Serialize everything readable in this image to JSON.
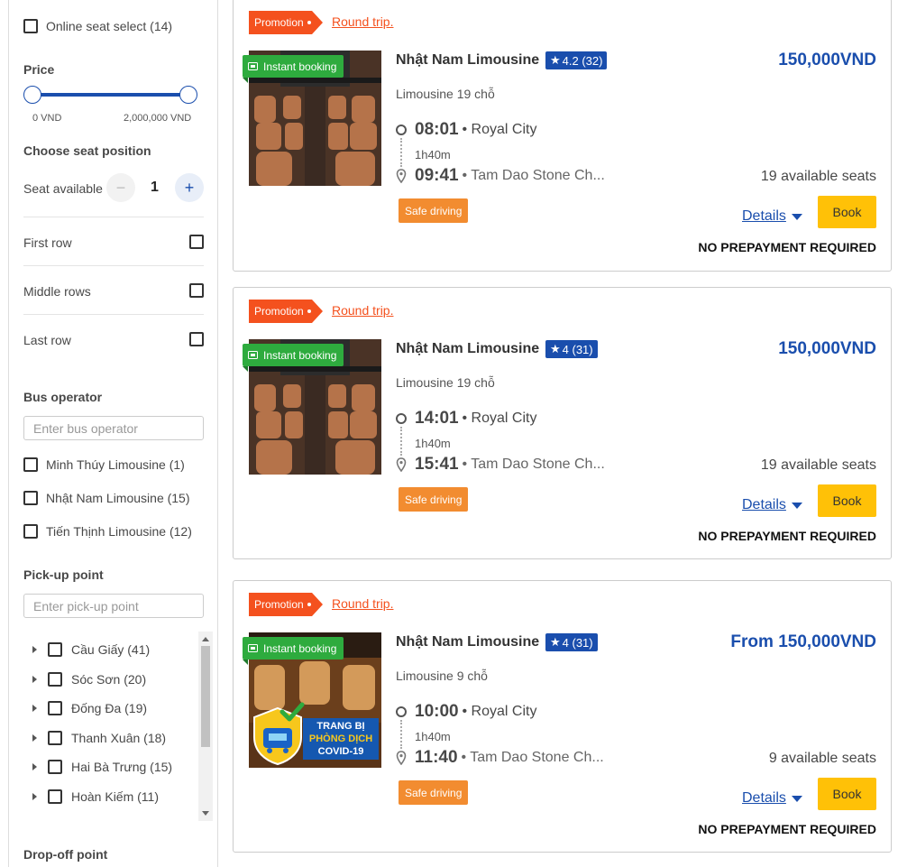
{
  "filters": {
    "online_seat": "Online seat select (14)",
    "price": {
      "title": "Price",
      "min_label": "0 VND",
      "max_label": "2,000,000 VND"
    },
    "seat_position": {
      "title": "Choose seat position",
      "seat_available_label": "Seat available",
      "seat_count": "1",
      "rows": [
        "First row",
        "Middle rows",
        "Last row"
      ]
    },
    "bus_operator": {
      "title": "Bus operator",
      "placeholder": "Enter bus operator",
      "options": [
        "Minh Thúy Limousine (1)",
        "Nhật Nam Limousine (15)",
        "Tiến Thịnh Limousine (12)"
      ]
    },
    "pickup": {
      "title": "Pick-up point",
      "placeholder": "Enter pick-up point",
      "options": [
        "Cầu Giấy (41)",
        "Sóc Sơn (20)",
        "Đống Đa (19)",
        "Thanh Xuân (18)",
        "Hai Bà Trưng (15)",
        "Hoàn Kiếm (11)"
      ]
    },
    "dropoff": {
      "title": "Drop-off point"
    }
  },
  "trips": [
    {
      "promo": "Promotion",
      "round_trip": "Round trip.",
      "instant": "Instant booking",
      "operator": "Nhật Nam Limousine",
      "rating": "4.2 (32)",
      "price": "150,000VND",
      "vehicle": "Limousine 19 chỗ",
      "depart_time": "08:01",
      "depart_place": "• Royal City",
      "duration": "1h40m",
      "arrive_time": "09:41",
      "arrive_place": "• Tam Dao Stone Ch...",
      "badge": "Safe driving",
      "seats": "19 available seats",
      "details": "Details",
      "book": "Book",
      "note": "NO PREPAYMENT REQUIRED"
    },
    {
      "promo": "Promotion",
      "round_trip": "Round trip.",
      "instant": "Instant booking",
      "operator": "Nhật Nam Limousine",
      "rating": "4 (31)",
      "price": "150,000VND",
      "vehicle": "Limousine 19 chỗ",
      "depart_time": "14:01",
      "depart_place": "• Royal City",
      "duration": "1h40m",
      "arrive_time": "15:41",
      "arrive_place": "• Tam Dao Stone Ch...",
      "badge": "Safe driving",
      "seats": "19 available seats",
      "details": "Details",
      "book": "Book",
      "note": "NO PREPAYMENT REQUIRED"
    },
    {
      "promo": "Promotion",
      "round_trip": "Round trip.",
      "instant": "Instant booking",
      "operator": "Nhật Nam Limousine",
      "rating": "4 (31)",
      "price": "From 150,000VND",
      "vehicle": "Limousine 9 chỗ",
      "depart_time": "10:00",
      "depart_place": "• Royal City",
      "duration": "1h40m",
      "arrive_time": "11:40",
      "arrive_place": "• Tam Dao Stone Ch...",
      "badge": "Safe driving",
      "seats": "9 available seats",
      "details": "Details",
      "book": "Book",
      "note": "NO PREPAYMENT REQUIRED",
      "image_text": [
        "TRANG BỊ",
        "PHÒNG DỊCH",
        "COVID-19"
      ]
    }
  ],
  "colors": {
    "brand_blue": "#1A4EAD",
    "promo_orange": "#F4511E",
    "instant_green": "#2EAB3E",
    "safe_orange": "#F28C30",
    "book_yellow": "#FFC107"
  }
}
